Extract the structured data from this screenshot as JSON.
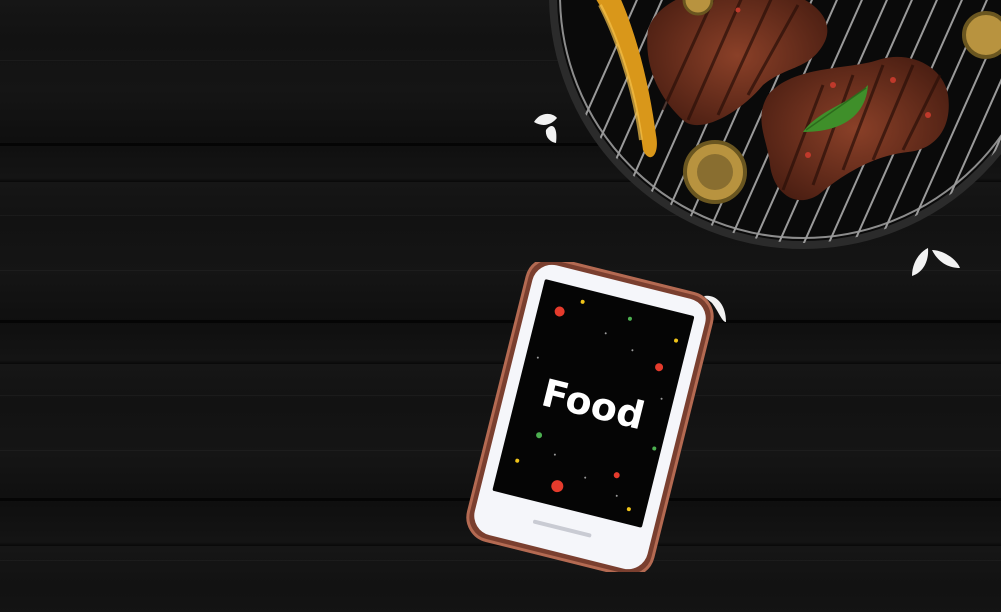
{
  "phone": {
    "app_label": "Food"
  },
  "colors": {
    "background": "#121212",
    "phone_frame": "#8a4a38",
    "phone_screen": "#050505",
    "text": "#ffffff",
    "steak": "#6b2e1c",
    "pepper": "#e0a21c",
    "basil": "#3f8f2a"
  }
}
